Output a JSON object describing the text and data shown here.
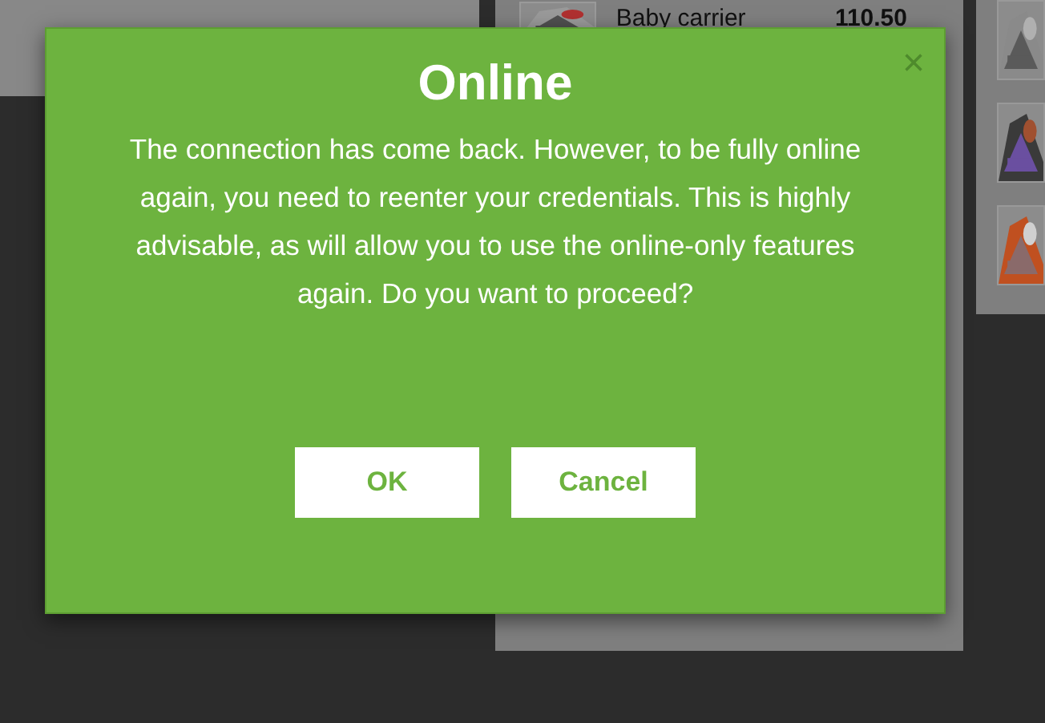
{
  "background": {
    "product_row": {
      "name": "Baby carrier",
      "price": "110.50"
    }
  },
  "dialog": {
    "title": "Online",
    "close": "×",
    "message": "The connection has come back. However, to be fully online again, you need to reenter your credentials. This is highly advisable, as will allow you to use the online-only features again. Do you want to proceed?",
    "buttons": [
      {
        "label": "OK"
      },
      {
        "label": "Cancel"
      }
    ]
  }
}
